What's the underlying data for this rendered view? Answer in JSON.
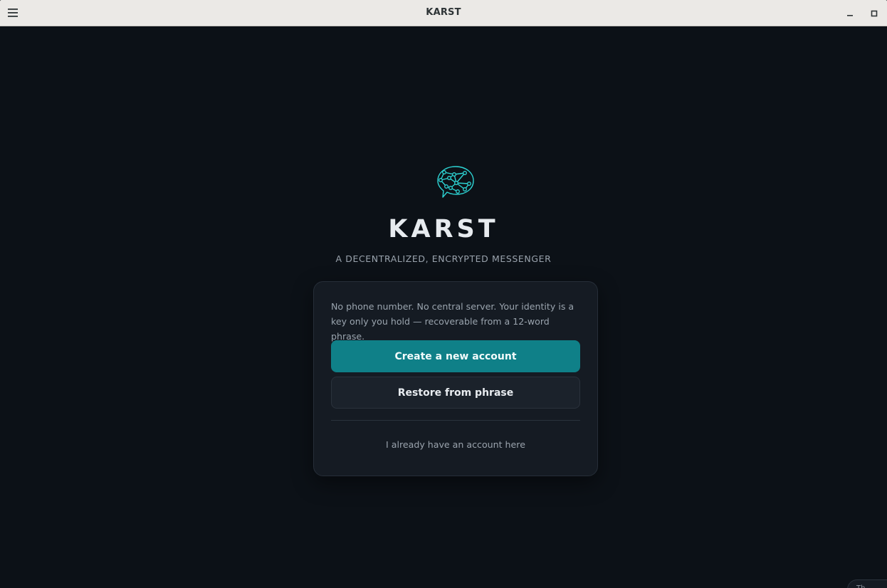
{
  "window": {
    "title": "KARST"
  },
  "icons": {
    "menu": "hamburger-menu-icon",
    "minimize": "minimize-icon",
    "maximize": "maximize-icon",
    "logo": "network-chat-bubble-logo"
  },
  "colors": {
    "background": "#0c1117",
    "accent": "#0f8088",
    "logo_stroke": "#2dd4d4",
    "card": "#151b23"
  },
  "hero": {
    "app_name": "KARST",
    "tagline": "A DECENTRALIZED, ENCRYPTED MESSENGER"
  },
  "card": {
    "description": "No phone number. No central server. Your identity is a key only you hold — recoverable from a 12-word phrase.",
    "create_label": "Create a new account",
    "restore_label": "Restore from phrase",
    "existing_label": "I already have an account here"
  },
  "corner_widget": {
    "label": "Th"
  }
}
